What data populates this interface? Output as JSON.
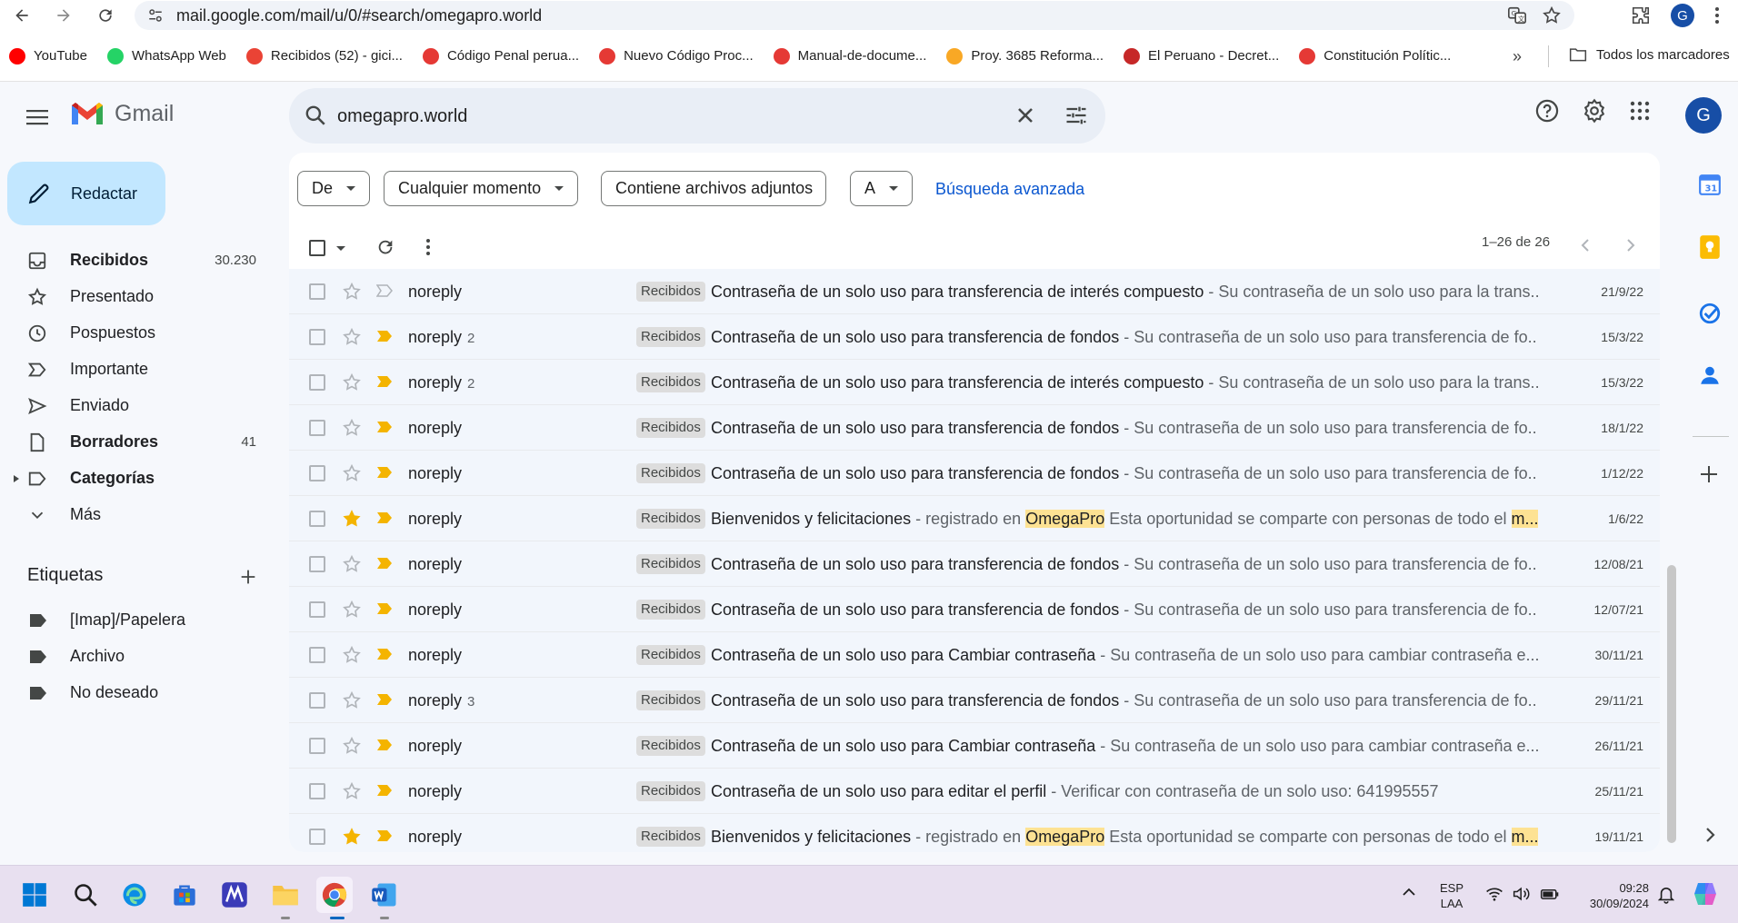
{
  "browser": {
    "url": "mail.google.com/mail/u/0/#search/omegapro.world",
    "profile_initial": "G",
    "bookmarks": [
      {
        "label": "YouTube",
        "color": "#ff0000"
      },
      {
        "label": "WhatsApp Web",
        "color": "#25d366"
      },
      {
        "label": "Recibidos (52) - gici...",
        "color": "#ea4335"
      },
      {
        "label": "Código Penal perua...",
        "color": "#e53935"
      },
      {
        "label": "Nuevo Código Proc...",
        "color": "#e53935"
      },
      {
        "label": "Manual-de-docume...",
        "color": "#e53935"
      },
      {
        "label": "Proy. 3685 Reforma...",
        "color": "#f9a825"
      },
      {
        "label": "El Peruano - Decret...",
        "color": "#c62828"
      },
      {
        "label": "Constitución Polític...",
        "color": "#e53935"
      }
    ],
    "bookmarks_more": "»",
    "all_bookmarks": "Todos los marcadores"
  },
  "gmail": {
    "logo_text": "Gmail",
    "search_value": "omegapro.world",
    "avatar_initial": "G",
    "compose_label": "Redactar",
    "nav": [
      {
        "label": "Recibidos",
        "count": "30.230",
        "bold": true,
        "icon": "inbox-icon"
      },
      {
        "label": "Presentado",
        "count": "",
        "bold": false,
        "icon": "star-icon"
      },
      {
        "label": "Pospuestos",
        "count": "",
        "bold": false,
        "icon": "clock-icon"
      },
      {
        "label": "Importante",
        "count": "",
        "bold": false,
        "icon": "important-icon"
      },
      {
        "label": "Enviado",
        "count": "",
        "bold": false,
        "icon": "send-icon"
      },
      {
        "label": "Borradores",
        "count": "41",
        "bold": true,
        "icon": "draft-icon"
      },
      {
        "label": "Categorías",
        "count": "",
        "bold": true,
        "icon": "label-icon"
      },
      {
        "label": "Más",
        "count": "",
        "bold": false,
        "icon": "chevron-down-icon"
      }
    ],
    "labels_title": "Etiquetas",
    "labels": [
      "[Imap]/Papelera",
      "Archivo",
      "No deseado"
    ],
    "filters": {
      "from": "De",
      "time": "Cualquier momento",
      "attachments": "Contiene archivos adjuntos",
      "to": "A",
      "advanced": "Búsqueda avanzada"
    },
    "pager": "1–26 de 26",
    "emails": [
      {
        "sender": "noreply",
        "count": "",
        "starred": false,
        "important": false,
        "tag": "Recibidos",
        "subject": "Contraseña de un solo uso para transferencia de interés compuesto",
        "snippet": " - Su contraseña de un solo uso para la trans...",
        "date": "21/9/22"
      },
      {
        "sender": "noreply",
        "count": "2",
        "starred": false,
        "important": true,
        "tag": "Recibidos",
        "subject": "Contraseña de un solo uso para transferencia de fondos",
        "snippet": " - Su contraseña de un solo uso para transferencia de fo...",
        "date": "15/3/22"
      },
      {
        "sender": "noreply",
        "count": "2",
        "starred": false,
        "important": true,
        "tag": "Recibidos",
        "subject": "Contraseña de un solo uso para transferencia de interés compuesto",
        "snippet": " - Su contraseña de un solo uso para la trans...",
        "date": "15/3/22"
      },
      {
        "sender": "noreply",
        "count": "",
        "starred": false,
        "important": true,
        "tag": "Recibidos",
        "subject": "Contraseña de un solo uso para transferencia de fondos",
        "snippet": " - Su contraseña de un solo uso para transferencia de fo...",
        "date": "18/1/22"
      },
      {
        "sender": "noreply",
        "count": "",
        "starred": false,
        "important": true,
        "tag": "Recibidos",
        "subject": "Contraseña de un solo uso para transferencia de fondos",
        "snippet": " - Su contraseña de un solo uso para transferencia de fo...",
        "date": "1/12/22"
      },
      {
        "sender": "noreply",
        "count": "",
        "starred": true,
        "important": true,
        "tag": "Recibidos",
        "subject": "Bienvenidos y felicitaciones",
        "snippet": " - registrado en ",
        "hl1": "OmegaPro",
        "snippet2": " Esta oportunidad se comparte con personas de todo el ",
        "hl2": "m...",
        "date": "1/6/22"
      },
      {
        "sender": "noreply",
        "count": "",
        "starred": false,
        "important": true,
        "tag": "Recibidos",
        "subject": "Contraseña de un solo uso para transferencia de fondos",
        "snippet": " - Su contraseña de un solo uso para transferencia de fo...",
        "date": "12/08/21"
      },
      {
        "sender": "noreply",
        "count": "",
        "starred": false,
        "important": true,
        "tag": "Recibidos",
        "subject": "Contraseña de un solo uso para transferencia de fondos",
        "snippet": " - Su contraseña de un solo uso para transferencia de fo...",
        "date": "12/07/21"
      },
      {
        "sender": "noreply",
        "count": "",
        "starred": false,
        "important": true,
        "tag": "Recibidos",
        "subject": "Contraseña de un solo uso para Cambiar contraseña",
        "snippet": " - Su contraseña de un solo uso para cambiar contraseña e...",
        "date": "30/11/21"
      },
      {
        "sender": "noreply",
        "count": "3",
        "starred": false,
        "important": true,
        "tag": "Recibidos",
        "subject": "Contraseña de un solo uso para transferencia de fondos",
        "snippet": " - Su contraseña de un solo uso para transferencia de fo...",
        "date": "29/11/21"
      },
      {
        "sender": "noreply",
        "count": "",
        "starred": false,
        "important": true,
        "tag": "Recibidos",
        "subject": "Contraseña de un solo uso para Cambiar contraseña",
        "snippet": " - Su contraseña de un solo uso para cambiar contraseña e...",
        "date": "26/11/21"
      },
      {
        "sender": "noreply",
        "count": "",
        "starred": false,
        "important": true,
        "tag": "Recibidos",
        "subject": "Contraseña de un solo uso para editar el perfil",
        "snippet": " - Verificar con contraseña de un solo uso: 641995557",
        "date": "25/11/21"
      },
      {
        "sender": "noreply",
        "count": "",
        "starred": true,
        "important": true,
        "tag": "Recibidos",
        "subject": "Bienvenidos y felicitaciones",
        "snippet": " - registrado en ",
        "hl1": "OmegaPro",
        "snippet2": " Esta oportunidad se comparte con personas de todo el ",
        "hl2": "m...",
        "date": "19/11/21"
      }
    ]
  },
  "taskbar": {
    "lang1": "ESP",
    "lang2": "LAA",
    "time": "09:28",
    "date": "30/09/2024"
  },
  "colors": {
    "compose_bg": "#c2e7ff",
    "search_bg": "#e9eef6",
    "link": "#0b57d0",
    "important": "#f4b400",
    "highlight": "#fde293"
  }
}
